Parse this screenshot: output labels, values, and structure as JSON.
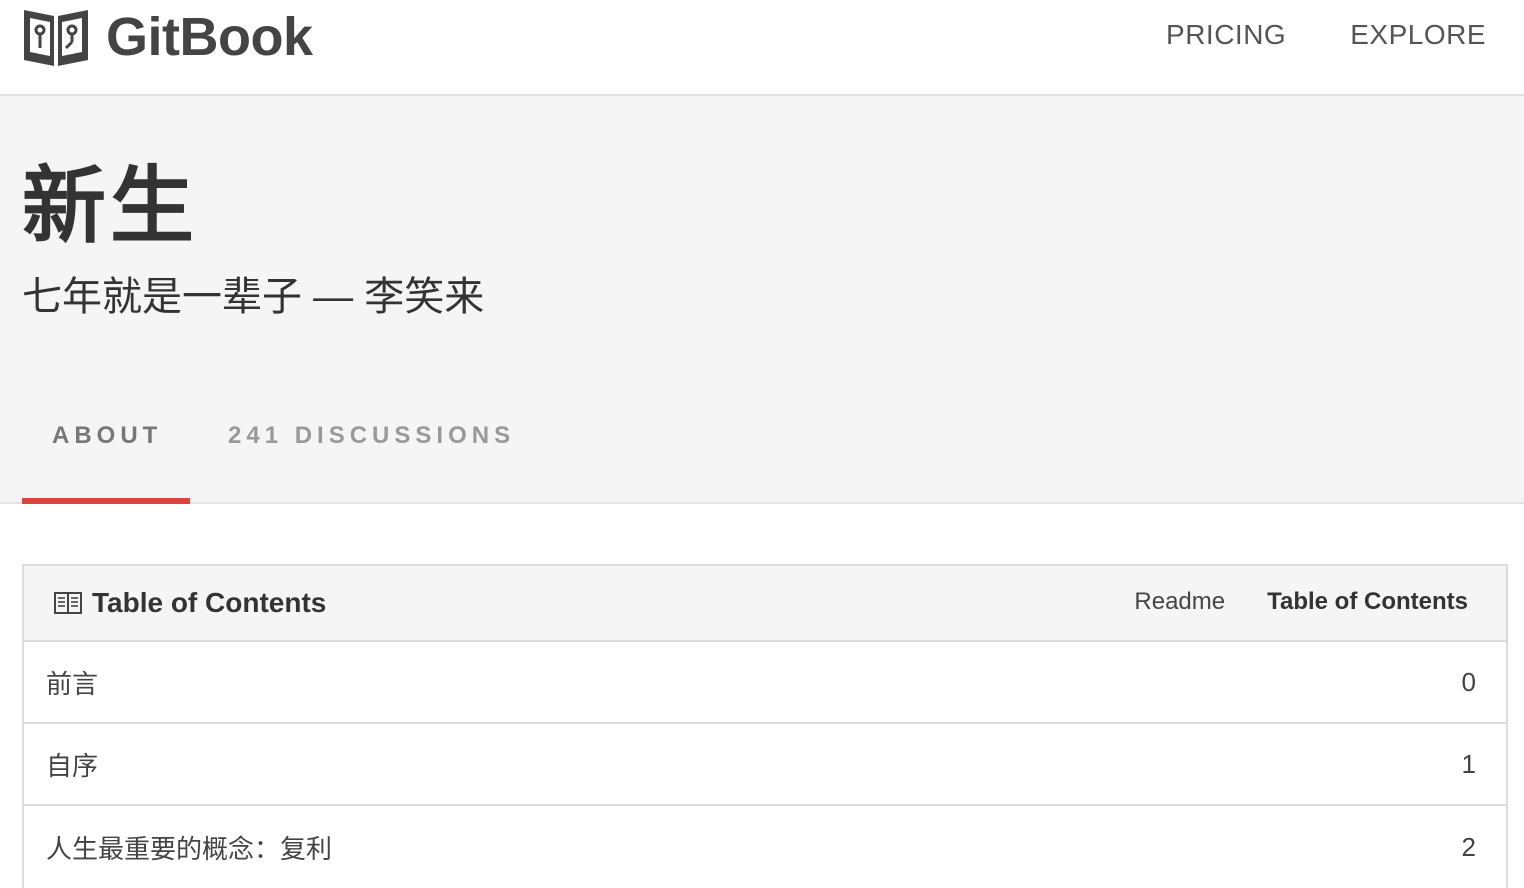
{
  "header": {
    "logo_text": "GitBook",
    "nav": [
      {
        "label": "PRICING"
      },
      {
        "label": "EXPLORE"
      }
    ]
  },
  "book": {
    "title": "新生",
    "description": "七年就是一辈子 — 李笑来"
  },
  "tabs": [
    {
      "label": "ABOUT",
      "active": true
    },
    {
      "label": "241 DISCUSSIONS",
      "active": false
    }
  ],
  "toc": {
    "title": "Table of Contents",
    "icon": "book-open-icon",
    "links": [
      {
        "label": "Readme"
      },
      {
        "label": "Table of Contents"
      }
    ],
    "rows": [
      {
        "label": "前言",
        "number": "0"
      },
      {
        "label": "自序",
        "number": "1"
      },
      {
        "label": "人生最重要的概念：复利",
        "number": "2"
      }
    ]
  },
  "colors": {
    "accent": "#d9453a",
    "hero_bg": "#f5f5f5",
    "text": "#333333"
  }
}
